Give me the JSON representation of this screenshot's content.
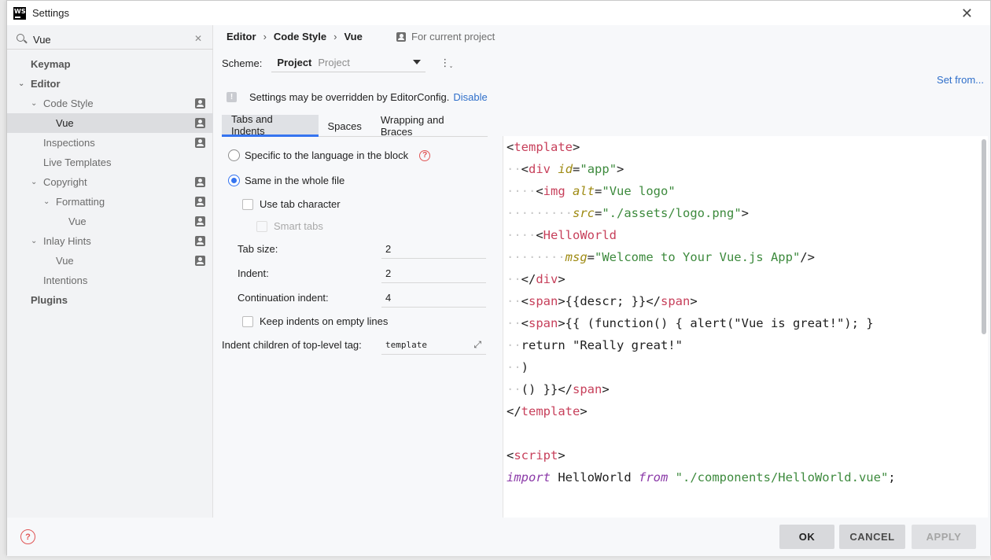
{
  "window": {
    "title": "Settings",
    "app_icon_text": "WS"
  },
  "search": {
    "value": "Vue"
  },
  "tree": [
    {
      "label": "Keymap",
      "level": 0,
      "bold": true,
      "chevron": false,
      "project": false,
      "selected": false
    },
    {
      "label": "Editor",
      "level": 0,
      "bold": true,
      "chevron": true,
      "project": false,
      "selected": false
    },
    {
      "label": "Code Style",
      "level": 1,
      "bold": false,
      "chevron": true,
      "project": true,
      "selected": false
    },
    {
      "label": "Vue",
      "level": 2,
      "bold": false,
      "chevron": false,
      "project": true,
      "selected": true
    },
    {
      "label": "Inspections",
      "level": 1,
      "bold": false,
      "chevron": false,
      "project": true,
      "selected": false
    },
    {
      "label": "Live Templates",
      "level": 1,
      "bold": false,
      "chevron": false,
      "project": false,
      "selected": false
    },
    {
      "label": "Copyright",
      "level": 1,
      "bold": false,
      "chevron": true,
      "project": true,
      "selected": false
    },
    {
      "label": "Formatting",
      "level": 2,
      "bold": false,
      "chevron": true,
      "project": true,
      "selected": false
    },
    {
      "label": "Vue",
      "level": 3,
      "bold": false,
      "chevron": false,
      "project": true,
      "selected": false
    },
    {
      "label": "Inlay Hints",
      "level": 1,
      "bold": false,
      "chevron": true,
      "project": true,
      "selected": false
    },
    {
      "label": "Vue",
      "level": 2,
      "bold": false,
      "chevron": false,
      "project": true,
      "selected": false
    },
    {
      "label": "Intentions",
      "level": 1,
      "bold": false,
      "chevron": false,
      "project": false,
      "selected": false
    },
    {
      "label": "Plugins",
      "level": 0,
      "bold": true,
      "chevron": false,
      "project": false,
      "selected": false
    }
  ],
  "breadcrumb": {
    "items": [
      "Editor",
      "Code Style",
      "Vue"
    ],
    "for_project": "For current project"
  },
  "scheme": {
    "label": "Scheme:",
    "value": "Project",
    "sub_value": "Project",
    "set_from": "Set from..."
  },
  "notice": {
    "text": "Settings may be overridden by EditorConfig.",
    "link": "Disable"
  },
  "tabs": [
    {
      "label": "Tabs and Indents",
      "active": true
    },
    {
      "label": "Spaces",
      "active": false
    },
    {
      "label": "Wrapping and Braces",
      "active": false
    }
  ],
  "options": {
    "radio_specific": "Specific to the language in the block",
    "radio_same": "Same in the whole file",
    "use_tab": "Use tab character",
    "smart_tabs": "Smart tabs",
    "tab_size_label": "Tab size:",
    "tab_size": "2",
    "indent_label": "Indent:",
    "indent": "2",
    "cont_indent_label": "Continuation indent:",
    "cont_indent": "4",
    "keep_indents": "Keep indents on empty lines",
    "indent_children_label": "Indent children of top-level tag:",
    "indent_children": "template"
  },
  "code_lines": [
    [
      [
        "t",
        "<"
      ],
      [
        "tag",
        "template"
      ],
      [
        "t",
        ">"
      ]
    ],
    [
      [
        "ws",
        "··"
      ],
      [
        "t",
        "<"
      ],
      [
        "tag",
        "div"
      ],
      [
        "t",
        " "
      ],
      [
        "attr",
        "id"
      ],
      [
        "t",
        "="
      ],
      [
        "str",
        "\"app\""
      ],
      [
        "t",
        ">"
      ]
    ],
    [
      [
        "ws",
        "····"
      ],
      [
        "t",
        "<"
      ],
      [
        "tag",
        "img"
      ],
      [
        "t",
        " "
      ],
      [
        "attr",
        "alt"
      ],
      [
        "t",
        "="
      ],
      [
        "str",
        "\"Vue logo\""
      ]
    ],
    [
      [
        "ws",
        "·········"
      ],
      [
        "attr",
        "src"
      ],
      [
        "t",
        "="
      ],
      [
        "str",
        "\"./assets/logo.png\""
      ],
      [
        "t",
        ">"
      ]
    ],
    [
      [
        "ws",
        "····"
      ],
      [
        "t",
        "<"
      ],
      [
        "tag",
        "HelloWorld"
      ]
    ],
    [
      [
        "ws",
        "········"
      ],
      [
        "attr",
        "msg"
      ],
      [
        "t",
        "="
      ],
      [
        "str",
        "\"Welcome to Your Vue.js App\""
      ],
      [
        "t",
        "/>"
      ]
    ],
    [
      [
        "ws",
        "··"
      ],
      [
        "t",
        "</"
      ],
      [
        "tag",
        "div"
      ],
      [
        "t",
        ">"
      ]
    ],
    [
      [
        "ws",
        "··"
      ],
      [
        "t",
        "<"
      ],
      [
        "tag",
        "span"
      ],
      [
        "t",
        ">{{descr; }}</"
      ],
      [
        "tag",
        "span"
      ],
      [
        "t",
        ">"
      ]
    ],
    [
      [
        "ws",
        "··"
      ],
      [
        "t",
        "<"
      ],
      [
        "tag",
        "span"
      ],
      [
        "t",
        ">{{ (function() { alert(\"Vue is great!\"); }"
      ]
    ],
    [
      [
        "ws",
        "··"
      ],
      [
        "t",
        "return \"Really great!\""
      ]
    ],
    [
      [
        "ws",
        "··"
      ],
      [
        "t",
        ")"
      ]
    ],
    [
      [
        "ws",
        "··"
      ],
      [
        "t",
        "() }}</"
      ],
      [
        "tag",
        "span"
      ],
      [
        "t",
        ">"
      ]
    ],
    [
      [
        "t",
        "</"
      ],
      [
        "tag",
        "template"
      ],
      [
        "t",
        ">"
      ]
    ],
    [
      [
        "t",
        ""
      ]
    ],
    [
      [
        "t",
        "<"
      ],
      [
        "tag",
        "script"
      ],
      [
        "t",
        ">"
      ]
    ],
    [
      [
        "kw",
        "import"
      ],
      [
        "t",
        " HelloWorld "
      ],
      [
        "kw",
        "from"
      ],
      [
        "t",
        " "
      ],
      [
        "str",
        "\"./components/HelloWorld.vue\""
      ],
      [
        "t",
        ";"
      ]
    ]
  ],
  "footer": {
    "ok": "OK",
    "cancel": "CANCEL",
    "apply": "APPLY"
  }
}
